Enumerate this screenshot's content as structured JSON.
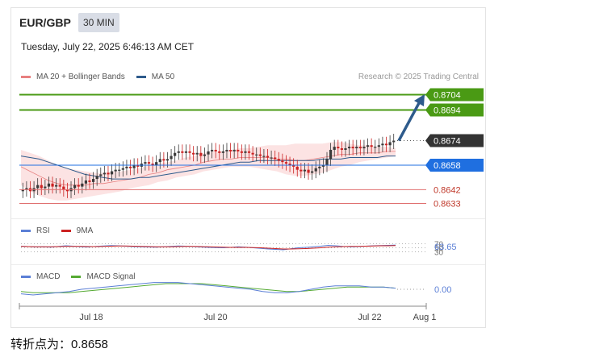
{
  "header": {
    "pair": "EUR/GBP",
    "timeframe": "30 MIN",
    "datetime": "Tuesday, July 22, 2025 6:46:13 AM CET",
    "research": "Research © 2025 Trading Central"
  },
  "legends": {
    "main": [
      {
        "label": "MA 20 + Bollinger Bands",
        "color": "#e88080"
      },
      {
        "label": "MA 50",
        "color": "#2e5b8c"
      }
    ],
    "rsi": [
      {
        "label": "RSI",
        "color": "#5b7fd6"
      },
      {
        "label": "9MA",
        "color": "#cc2222"
      }
    ],
    "macd": [
      {
        "label": "MACD",
        "color": "#5b7fd6"
      },
      {
        "label": "MACD Signal",
        "color": "#55aa33"
      }
    ]
  },
  "colors": {
    "resistance": "#4a9a14",
    "pivot": "#1f6fe0",
    "support": "#e07070",
    "current": "#333333",
    "candle_up": "#3a3a3a",
    "candle_down": "#cc2222",
    "band_fill": "#fbd9d9",
    "arrow": "#2e5b8c"
  },
  "chart_data": {
    "type": "candlestick",
    "x_ticks": [
      "Jul 18",
      "Jul 20",
      "Jul 22",
      "Aug 1"
    ],
    "ylim": [
      0.8628,
      0.8709
    ],
    "levels": [
      {
        "value": 0.8704,
        "label": "0.8704",
        "kind": "resistance"
      },
      {
        "value": 0.8694,
        "label": "0.8694",
        "kind": "resistance"
      },
      {
        "value": 0.8674,
        "label": "0.8674",
        "kind": "current"
      },
      {
        "value": 0.8658,
        "label": "0.8658",
        "kind": "pivot"
      },
      {
        "value": 0.8642,
        "label": "0.8642",
        "kind": "support"
      },
      {
        "value": 0.8633,
        "label": "0.8633",
        "kind": "support"
      }
    ],
    "close": [
      0.8642,
      0.8643,
      0.8641,
      0.8643,
      0.8645,
      0.8643,
      0.8644,
      0.8646,
      0.8644,
      0.8645,
      0.8644,
      0.8642,
      0.8641,
      0.8643,
      0.8645,
      0.8644,
      0.8646,
      0.8648,
      0.8647,
      0.8649,
      0.8651,
      0.8652,
      0.8653,
      0.8652,
      0.8654,
      0.8655,
      0.8655,
      0.8656,
      0.8657,
      0.8656,
      0.8658,
      0.8657,
      0.8659,
      0.866,
      0.8659,
      0.8658,
      0.866,
      0.8662,
      0.8661,
      0.8662,
      0.8664,
      0.8666,
      0.8667,
      0.8666,
      0.8667,
      0.8666,
      0.8665,
      0.8666,
      0.8664,
      0.8665,
      0.8667,
      0.8668,
      0.8667,
      0.8666,
      0.8667,
      0.8668,
      0.8667,
      0.8668,
      0.8667,
      0.8666,
      0.8667,
      0.8666,
      0.8665,
      0.8665,
      0.8664,
      0.8664,
      0.8663,
      0.8663,
      0.8662,
      0.8661,
      0.866,
      0.8659,
      0.8658,
      0.8657,
      0.8655,
      0.8654,
      0.8655,
      0.8653,
      0.8654,
      0.8656,
      0.8657,
      0.8658,
      0.8662,
      0.8668,
      0.867,
      0.8669,
      0.8668,
      0.8669,
      0.867,
      0.8669,
      0.867,
      0.8669,
      0.867,
      0.8671,
      0.867,
      0.867,
      0.8671,
      0.8672,
      0.8671,
      0.8673,
      0.8674
    ],
    "bb_upper": [
      0.8668,
      0.8666,
      0.8664,
      0.8661,
      0.8658,
      0.8656,
      0.8655,
      0.8654,
      0.8653,
      0.8653,
      0.8654,
      0.8654,
      0.8655,
      0.8656,
      0.8658,
      0.8659,
      0.866,
      0.8661,
      0.8663,
      0.8664,
      0.8666,
      0.8667,
      0.8667,
      0.8668,
      0.8669,
      0.8669,
      0.867,
      0.8671,
      0.8671,
      0.8671,
      0.8672,
      0.8672,
      0.8672,
      0.8672,
      0.8673,
      0.8673,
      0.8672,
      0.8671,
      0.8671,
      0.867,
      0.867,
      0.8669
    ],
    "bb_lower": [
      0.8645,
      0.8641,
      0.8638,
      0.8636,
      0.8635,
      0.8635,
      0.8636,
      0.8637,
      0.8638,
      0.8639,
      0.864,
      0.8641,
      0.8643,
      0.8644,
      0.8645,
      0.8647,
      0.8648,
      0.865,
      0.8651,
      0.8652,
      0.8654,
      0.8655,
      0.8656,
      0.8657,
      0.8657,
      0.8657,
      0.8656,
      0.8655,
      0.8654,
      0.8652,
      0.8651,
      0.8651,
      0.8652,
      0.8653,
      0.8655,
      0.8657,
      0.8658,
      0.866,
      0.8661,
      0.8662,
      0.8663,
      0.8664
    ],
    "ma20": [
      0.8657,
      0.8654,
      0.8651,
      0.8648,
      0.8646,
      0.8645,
      0.8645,
      0.8645,
      0.8646,
      0.8646,
      0.8647,
      0.8648,
      0.8649,
      0.865,
      0.8652,
      0.8653,
      0.8655,
      0.8656,
      0.8657,
      0.8658,
      0.866,
      0.8661,
      0.8662,
      0.8662,
      0.8663,
      0.8663,
      0.8663,
      0.8663,
      0.8662,
      0.8662,
      0.8661,
      0.8661,
      0.8662,
      0.8663,
      0.8664,
      0.8665,
      0.8665,
      0.8666,
      0.8666,
      0.8666,
      0.8667,
      0.8667
    ],
    "ma50": [
      0.8664,
      0.8663,
      0.8662,
      0.866,
      0.8658,
      0.8656,
      0.8654,
      0.8652,
      0.8651,
      0.865,
      0.8649,
      0.8649,
      0.8649,
      0.865,
      0.865,
      0.8651,
      0.8652,
      0.8653,
      0.8654,
      0.8655,
      0.8656,
      0.8657,
      0.8658,
      0.8659,
      0.866,
      0.866,
      0.8661,
      0.8661,
      0.8661,
      0.8661,
      0.8661,
      0.8661,
      0.8661,
      0.8662,
      0.8662,
      0.8662,
      0.8663,
      0.8663,
      0.8663,
      0.8663,
      0.8664,
      0.8664
    ],
    "projection": {
      "from": 0.8674,
      "to": 0.8704
    },
    "rsi": {
      "value_label": "63.65",
      "levels": [
        "70",
        "50",
        "30"
      ],
      "ylim": [
        0,
        100
      ],
      "rsi": [
        58,
        56,
        54,
        55,
        53,
        57,
        60,
        58,
        55,
        54,
        57,
        59,
        61,
        60,
        58,
        56,
        55,
        54,
        53,
        55,
        57,
        59,
        58,
        56,
        54,
        52,
        51,
        50,
        52,
        55,
        53,
        50,
        47,
        44,
        42,
        40,
        45,
        50,
        52,
        55,
        58,
        62,
        60,
        57,
        55,
        56,
        58,
        60,
        61,
        62,
        63.65
      ],
      "ma9": [
        57,
        56,
        55,
        55,
        55,
        56,
        57,
        57,
        57,
        56,
        56,
        57,
        58,
        59,
        59,
        58,
        57,
        56,
        55,
        55,
        55,
        56,
        57,
        57,
        56,
        55,
        54,
        53,
        52,
        52,
        52,
        51,
        50,
        48,
        46,
        44,
        44,
        45,
        46,
        48,
        50,
        53,
        55,
        56,
        57,
        57,
        58,
        59,
        60,
        60,
        61
      ]
    },
    "macd": {
      "value_label": "0.00",
      "macd": [
        -0.0004,
        -0.0005,
        -0.0004,
        -0.0003,
        -0.0002,
        0.0,
        0.0001,
        0.0002,
        0.0003,
        0.0004,
        0.0005,
        0.0006,
        0.0006,
        0.0006,
        0.0005,
        0.0004,
        0.0003,
        0.0002,
        0.0001,
        0.0,
        -0.0002,
        -0.0003,
        -0.0003,
        -0.0002,
        0.0,
        0.0002,
        0.0003,
        0.0003,
        0.0003,
        0.0002,
        0.0002,
        0.0001
      ],
      "signal": [
        -0.0002,
        -0.0003,
        -0.0003,
        -0.0003,
        -0.0003,
        -0.0002,
        -0.0001,
        0.0,
        0.0001,
        0.0002,
        0.0003,
        0.0004,
        0.0005,
        0.0005,
        0.0005,
        0.0005,
        0.0004,
        0.0003,
        0.0002,
        0.0001,
        0.0,
        -0.0001,
        -0.0002,
        -0.0002,
        -0.0001,
        0.0,
        0.0001,
        0.0002,
        0.0002,
        0.0002,
        0.0002,
        0.0001
      ]
    }
  },
  "footer": {
    "text": "转折点为：0.8658"
  }
}
